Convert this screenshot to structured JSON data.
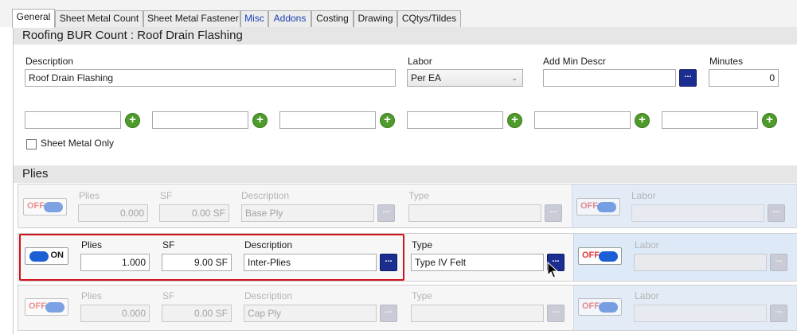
{
  "tabs": [
    {
      "label": "General",
      "active": true
    },
    {
      "label": "Sheet Metal Count"
    },
    {
      "label": "Sheet Metal Fastener"
    },
    {
      "label": "Misc"
    },
    {
      "label": "Addons"
    },
    {
      "label": "Costing"
    },
    {
      "label": "Drawing"
    },
    {
      "label": "CQtys/Tildes"
    }
  ],
  "header": {
    "title": "Roofing BUR Count : Roof Drain Flashing"
  },
  "general": {
    "description_label": "Description",
    "description_value": "Roof Drain Flashing",
    "labor_label": "Labor",
    "labor_value": "Per EA",
    "add_min_descr_label": "Add Min Descr",
    "add_min_descr_value": "",
    "minutes_label": "Minutes",
    "minutes_value": "0",
    "extra_fields": [
      "",
      "",
      "",
      "",
      "",
      ""
    ],
    "sheet_metal_only_label": "Sheet Metal Only",
    "sheet_metal_only_checked": false
  },
  "plies_section": {
    "title": "Plies"
  },
  "ply_rows": [
    {
      "toggle": "OFF",
      "plies_label": "Plies",
      "plies": "0.000",
      "sf_label": "SF",
      "sf": "0.00 SF",
      "description_label": "Description",
      "description": "Base Ply",
      "type_label": "Type",
      "type": "",
      "labor_toggle": "OFF",
      "labor_label": "Labor",
      "labor": ""
    },
    {
      "toggle": "ON",
      "plies_label": "Plies",
      "plies": "1.000",
      "sf_label": "SF",
      "sf": "9.00 SF",
      "description_label": "Description",
      "description": "Inter-Plies",
      "type_label": "Type",
      "type": "Type IV Felt",
      "labor_toggle": "OFF",
      "labor_label": "Labor",
      "labor": ""
    },
    {
      "toggle": "OFF",
      "plies_label": "Plies",
      "plies": "0.000",
      "sf_label": "SF",
      "sf": "0.00 SF",
      "description_label": "Description",
      "description": "Cap Ply",
      "type_label": "Type",
      "type": "",
      "labor_toggle": "OFF",
      "labor_label": "Labor",
      "labor": ""
    }
  ],
  "ellipsis": "...",
  "plus": "+",
  "colors": {
    "accent_button": "#1b2d8f",
    "toggle_knob": "#1c5fd4",
    "off_text": "#e03a3a",
    "highlight_box": "#d0121b",
    "add_icon": "#4e9a2b"
  }
}
